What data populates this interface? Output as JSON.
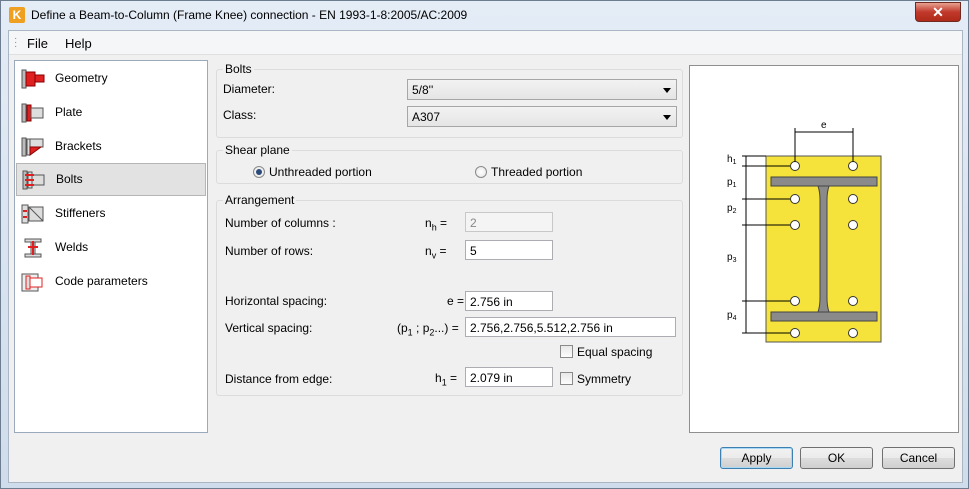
{
  "window": {
    "title": "Define a Beam-to-Column (Frame Knee) connection - EN 1993-1-8:2005/AC:2009",
    "app_icon": "K",
    "close_glyph": "✕"
  },
  "menu": {
    "file": "File",
    "help": "Help"
  },
  "nav": {
    "items": [
      {
        "label": "Geometry",
        "icon": "geometry-icon"
      },
      {
        "label": "Plate",
        "icon": "plate-icon"
      },
      {
        "label": "Brackets",
        "icon": "brackets-icon"
      },
      {
        "label": "Bolts",
        "icon": "bolts-icon",
        "selected": true
      },
      {
        "label": "Stiffeners",
        "icon": "stiffeners-icon"
      },
      {
        "label": "Welds",
        "icon": "welds-icon"
      },
      {
        "label": "Code parameters",
        "icon": "code-parameters-icon"
      }
    ]
  },
  "bolts": {
    "title": "Bolts",
    "diameter_label": "Diameter:",
    "diameter_value": "5/8''",
    "class_label": "Class:",
    "class_value": "A307"
  },
  "shear_plane": {
    "title": "Shear plane",
    "unthreaded": "Unthreaded portion",
    "threaded": "Threaded portion",
    "selected": "unthreaded"
  },
  "arrangement": {
    "title": "Arrangement",
    "columns_label": "Number of columns :",
    "columns_sym": "n",
    "columns_sub": "h",
    "columns_value": "2",
    "rows_label": "Number of rows:",
    "rows_sym": "n",
    "rows_sub": "v",
    "rows_value": "5",
    "hspacing_label": "Horizontal spacing:",
    "hspacing_sym": "e",
    "hspacing_value": "2.756 in",
    "vspacing_label": "Vertical spacing:",
    "vspacing_sym_open": "(p",
    "vspacing_sub1": "1",
    "vspacing_mid": " ; p",
    "vspacing_sub2": "2",
    "vspacing_sym_close": "...)",
    "vspacing_value": "2.756,2.756,5.512,2.756 in",
    "equal_spacing": "Equal spacing",
    "edge_label": "Distance from edge:",
    "edge_sym": "h",
    "edge_sub": "1",
    "edge_value": "2.079 in",
    "symmetry": "Symmetry",
    "equals": "="
  },
  "preview": {
    "e": "e",
    "h": "h",
    "h1_sub": "1",
    "p": "p",
    "p1_sub": "1",
    "p2_sub": "2",
    "p3_sub": "3",
    "p4_sub": "4",
    "plate_color": "#f5e23a",
    "beam_color": "#8a8a8a"
  },
  "buttons": {
    "apply": "Apply",
    "ok": "OK",
    "cancel": "Cancel"
  }
}
